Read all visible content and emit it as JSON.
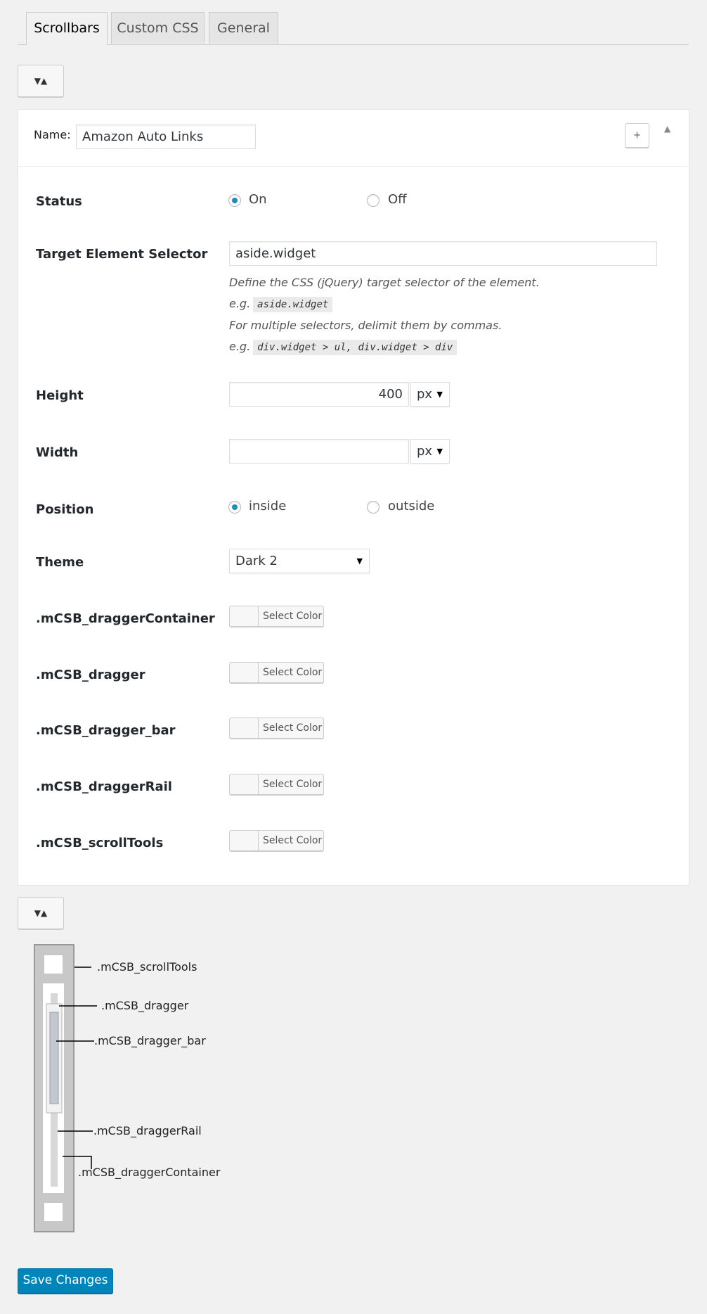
{
  "tabs": [
    {
      "label": "Scrollbars",
      "active": true
    },
    {
      "label": "Custom CSS",
      "active": false
    },
    {
      "label": "General",
      "active": false
    }
  ],
  "toggle_icon": "collapse-expand-arrows-icon",
  "panel": {
    "name_label": "Name:",
    "name_value": "Amazon Auto Links",
    "add_button": "+",
    "collapse_icon": "triangle-up-icon",
    "fields": {
      "status": {
        "label": "Status",
        "options": [
          "On",
          "Off"
        ],
        "selected": "On"
      },
      "target_selector": {
        "label": "Target Element Selector",
        "value": "aside.widget",
        "desc_line1": "Define the CSS (jQuery) target selector of the element.",
        "eg": "e.g.",
        "example1": "aside.widget",
        "desc_line2": "For multiple selectors, delimit them by commas.",
        "example2": "div.widget > ul, div.widget > div"
      },
      "height": {
        "label": "Height",
        "value": "400",
        "unit": "px"
      },
      "width": {
        "label": "Width",
        "value": "",
        "unit": "px"
      },
      "position": {
        "label": "Position",
        "options": [
          "inside",
          "outside"
        ],
        "selected": "inside"
      },
      "theme": {
        "label": "Theme",
        "value": "Dark 2"
      },
      "colors": [
        {
          "label": ".mCSB_draggerContainer",
          "button": "Select Color"
        },
        {
          "label": ".mCSB_dragger",
          "button": "Select Color"
        },
        {
          "label": ".mCSB_dragger_bar",
          "button": "Select Color"
        },
        {
          "label": ".mCSB_draggerRail",
          "button": "Select Color"
        },
        {
          "label": ".mCSB_scrollTools",
          "button": "Select Color"
        }
      ]
    }
  },
  "diagram": {
    "labels": {
      "scrollTools": ".mCSB_scrollTools",
      "dragger": ".mCSB_dragger",
      "dragger_bar": ".mCSB_dragger_bar",
      "draggerRail": ".mCSB_draggerRail",
      "draggerContainer": ".mCSB_draggerContainer"
    }
  },
  "save_button": "Save Changes",
  "colors": {
    "primary": "#0085ba",
    "radio_checked": "#1e8cbe",
    "background": "#f1f1f1"
  }
}
